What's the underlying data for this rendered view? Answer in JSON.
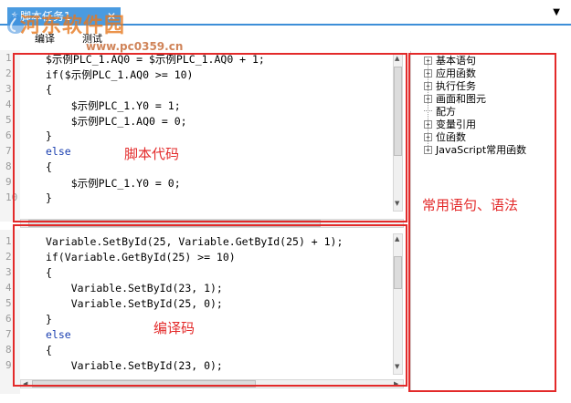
{
  "tab": {
    "title": "脚本任务1",
    "close_glyph": "✕",
    "star_glyph": "★"
  },
  "header": {
    "menu_arrow": "▼"
  },
  "watermark": {
    "title": "河东软件园",
    "url": "www.pc0359.cn"
  },
  "toolbar": {
    "item1": "编译",
    "item2": "测试"
  },
  "script_editor": {
    "line_numbers": [
      "1",
      "2",
      "3",
      "4",
      "5",
      "6",
      "7",
      "8",
      "9",
      "10"
    ],
    "lines": [
      "$示例PLC_1.AQ0 = $示例PLC_1.AQ0 + 1;",
      "if($示例PLC_1.AQ0 >= 10)",
      "{",
      "    $示例PLC_1.Y0 = 1;",
      "    $示例PLC_1.AQ0 = 0;",
      "}",
      "else",
      "{",
      "    $示例PLC_1.Y0 = 0;",
      "}"
    ]
  },
  "compiled_editor": {
    "line_numbers": [
      "1",
      "2",
      "3",
      "4",
      "5",
      "6",
      "7",
      "8",
      "9"
    ],
    "lines": [
      "Variable.SetById(25, Variable.GetById(25) + 1);",
      "if(Variable.GetById(25) >= 10)",
      "{",
      "    Variable.SetById(23, 1);",
      "    Variable.SetById(25, 0);",
      "}",
      "else",
      "{",
      "    Variable.SetById(23, 0);"
    ]
  },
  "annotations": {
    "script_code": "脚本代码",
    "compiled_code": "编译码",
    "common_statements": "常用语句、语法"
  },
  "function_tree": {
    "items": [
      {
        "label": "基本语句",
        "expandable": true
      },
      {
        "label": "应用函数",
        "expandable": true
      },
      {
        "label": "执行任务",
        "expandable": true
      },
      {
        "label": "画面和图元",
        "expandable": true
      },
      {
        "label": "配方",
        "expandable": false
      },
      {
        "label": "变量引用",
        "expandable": true
      },
      {
        "label": "位函数",
        "expandable": true
      },
      {
        "label": "JavaScript常用函数",
        "expandable": true
      }
    ],
    "plus_glyph": "+"
  },
  "scroll_glyphs": {
    "up": "▲",
    "down": "▼",
    "left": "◀",
    "right": "▶",
    "grip_v": "≡",
    "grip_h": "III"
  },
  "colors": {
    "accent": "#4a9be0",
    "annotation_red": "#e32a2a",
    "keyword_blue": "#1a3fb0"
  }
}
